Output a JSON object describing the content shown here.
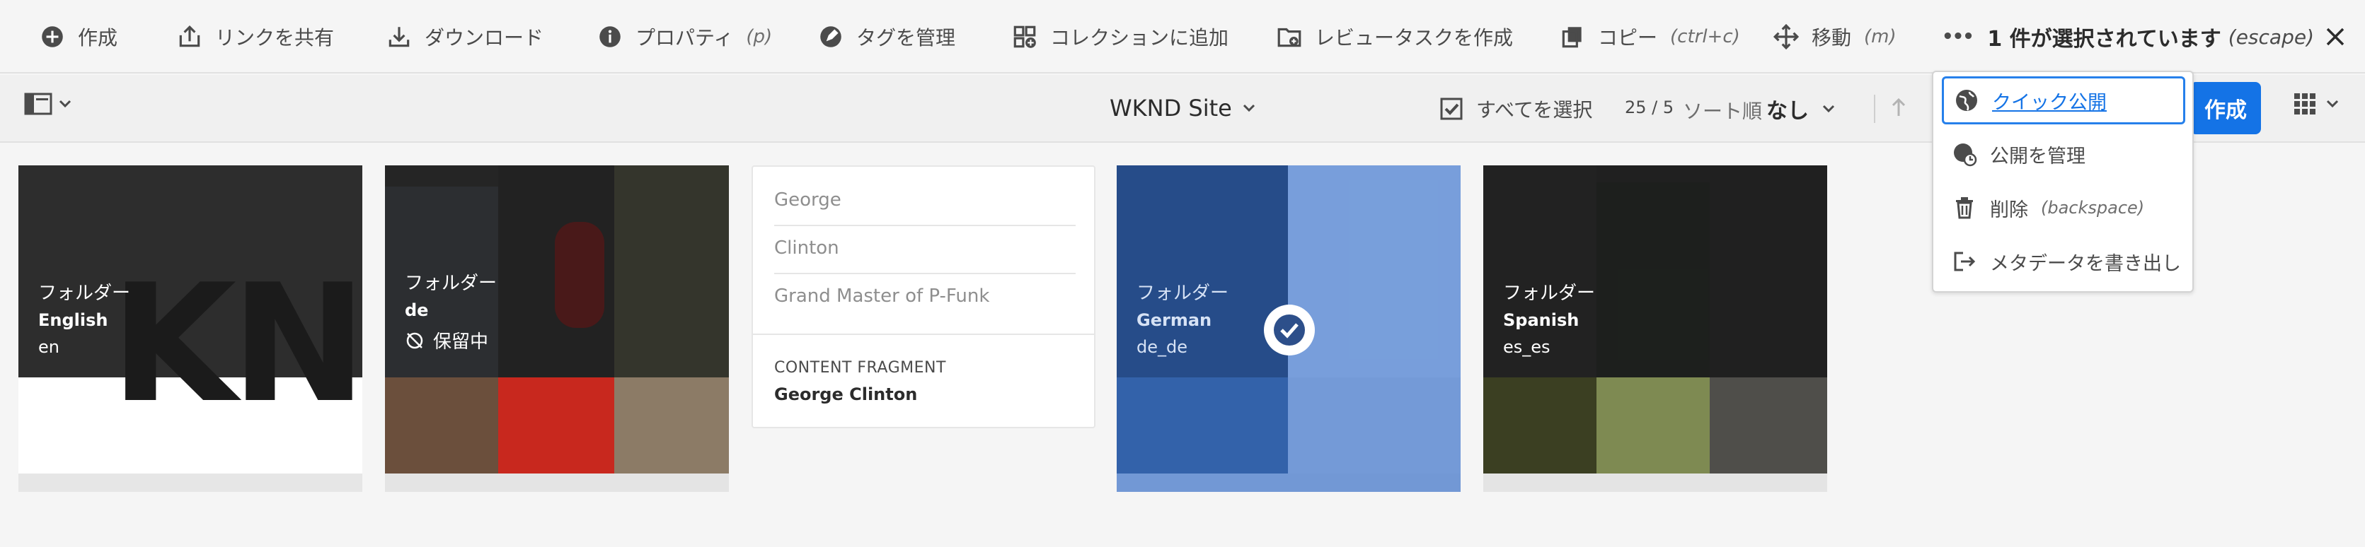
{
  "actionbar": {
    "create": "作成",
    "share_link": "リンクを共有",
    "download": "ダウンロード",
    "properties": "プロパティ",
    "properties_shortcut": "(p)",
    "manage_tags": "タグを管理",
    "add_to_collection": "コレクションに追加",
    "create_review_task": "レビュータスクを作成",
    "copy": "コピー",
    "copy_shortcut": "(ctrl+c)",
    "move": "移動",
    "move_shortcut": "(m)",
    "more": "•••",
    "selection_count": "1 件が選択されています",
    "selection_shortcut": "(escape)"
  },
  "toolbar": {
    "site_title": "WKND Site",
    "select_all": "すべてを選択",
    "count": "25 / 5",
    "sort_label": "ソート順",
    "sort_value": "なし",
    "create_button": "作成"
  },
  "cards": [
    {
      "kind": "フォルダー",
      "name": "English",
      "path": "en"
    },
    {
      "kind": "フォルダー",
      "name": "de",
      "status": "保留中"
    },
    {
      "fields": [
        "George",
        "Clinton",
        "Grand Master of P-Funk"
      ],
      "kind": "CONTENT FRAGMENT",
      "name": "George Clinton"
    },
    {
      "kind": "フォルダー",
      "name": "German",
      "path": "de_de",
      "selected": true
    },
    {
      "kind": "フォルダー",
      "name": "Spanish",
      "path": "es_es"
    }
  ],
  "menu": {
    "quick_publish": "クイック公開",
    "manage_publication": "公開を管理",
    "delete": "削除",
    "delete_shortcut": "(backspace)",
    "export_metadata": "メタデータを書き出し"
  },
  "colors": {
    "accent": "#1473e6",
    "focus": "#2680eb",
    "selected_overlay": "#2d5fb0"
  }
}
